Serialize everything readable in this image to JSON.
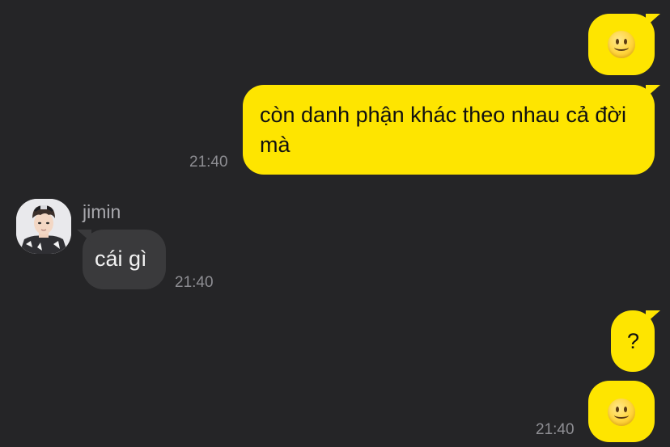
{
  "messages": {
    "msg1": {
      "emoji": "smiling-face-emoji"
    },
    "msg2": {
      "text": "còn danh phận khác theo nhau cả đời mà",
      "time": "21:40"
    },
    "msg3": {
      "sender": "jimin",
      "text": "cái gì",
      "time": "21:40"
    },
    "msg4": {
      "text": "?"
    },
    "msg5": {
      "emoji": "smiling-face-emoji",
      "time": "21:40"
    }
  },
  "colors": {
    "background": "#252527",
    "outgoing_bubble": "#FEE500",
    "incoming_bubble": "#3A3A3C",
    "timestamp": "#8e8e93"
  }
}
